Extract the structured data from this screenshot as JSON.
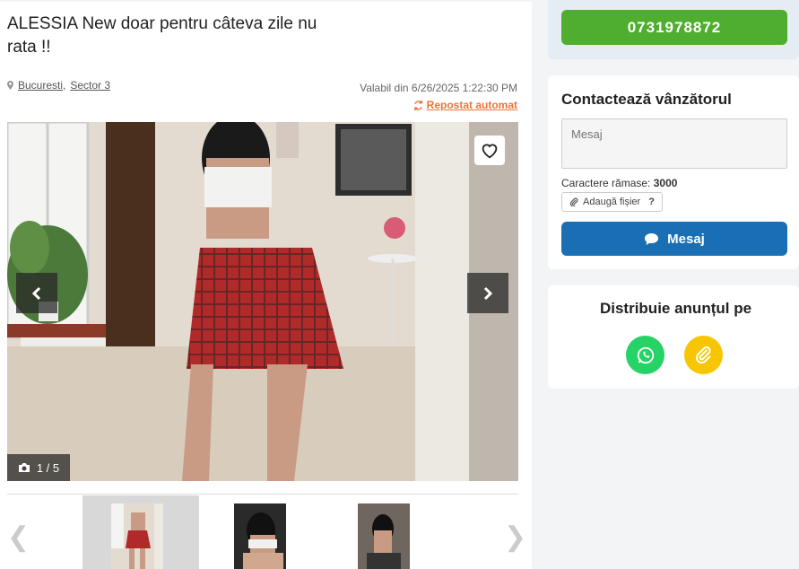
{
  "ad": {
    "title": "ALESSIA New doar pentru câteva zile nu rata !!",
    "location_city": "Bucuresti",
    "location_sep": ",",
    "location_sector": "Sector 3",
    "valid_text": "Valabil din 6/26/2025 1:22:30 PM",
    "repost_label": "Repostat automat"
  },
  "gallery": {
    "counter": "1 / 5",
    "prev_icon": "chevron-left-icon",
    "next_icon": "chevron-right-icon",
    "favorite_icon": "heart-icon",
    "thumb_prev": "❮",
    "thumb_next": "❯"
  },
  "contact": {
    "phone": "0731978872",
    "title": "Contactează vânzătorul",
    "message_placeholder": "Mesaj",
    "chars_label": "Caractere rămase:",
    "chars_value": "3000",
    "attach_label": "Adaugă fișier",
    "attach_help": "?",
    "send_label": "Mesaj"
  },
  "share": {
    "title": "Distribuie anunțul pe"
  },
  "colors": {
    "phone_green": "#4fad30",
    "send_blue": "#1a6fb4",
    "repost_orange": "#e8773a",
    "whatsapp": "#25d366",
    "link_yellow": "#f7c600"
  }
}
